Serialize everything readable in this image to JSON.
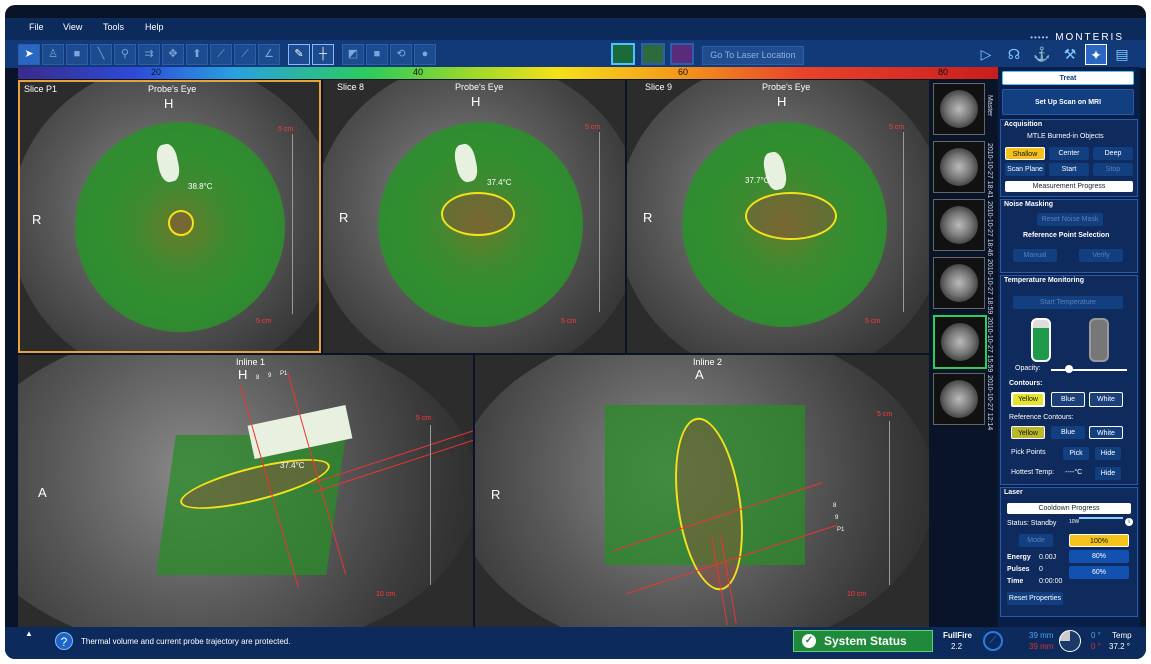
{
  "menu": {
    "file": "File",
    "view": "View",
    "tools": "Tools",
    "help": "Help"
  },
  "brand": {
    "name": "MONTERIS",
    "dots": "•••••"
  },
  "toolbar": {
    "goto": "Go To Laser Location"
  },
  "colorbar": {
    "t20": "20",
    "t40": "40",
    "t60": "60",
    "t80": "80"
  },
  "views": {
    "v1": {
      "slice": "Slice P1",
      "title": "Probe's Eye",
      "top": "H",
      "left": "R",
      "scale_top": "5 cm",
      "scale_bot": "5 cm",
      "temp": "38.8°C"
    },
    "v2": {
      "slice": "Slice 8",
      "title": "Probe's Eye",
      "top": "H",
      "left": "R",
      "scale_top": "5 cm",
      "scale_bot": "5 cm",
      "temp": "37.4°C"
    },
    "v3": {
      "slice": "Slice 9",
      "title": "Probe's Eye",
      "top": "H",
      "left": "R",
      "scale_top": "5 cm",
      "scale_bot": "5 cm",
      "temp": "37.7°C"
    },
    "v4": {
      "title": "Inline 1",
      "top": "H",
      "left": "A",
      "scale_top": "5 cm",
      "scale_bot": "10 cm",
      "temp": "37.4°C",
      "s8": "8",
      "s9": "9",
      "sp": "P1"
    },
    "v5": {
      "title": "Inline 2",
      "top": "A",
      "left": "R",
      "scale_top": "5 cm",
      "scale_bot": "10 cm",
      "s8": "8",
      "s9": "9",
      "sp": "P1"
    }
  },
  "thumbs": {
    "master": "Master",
    "t1": "2010-10-27 18:41",
    "t2": "2010-10-27 18:46",
    "t3": "2010-10-27 18:59",
    "t4": "2010-10-27 15:59",
    "t5": "2010-10-27 12:14"
  },
  "panel": {
    "treat": "Treat",
    "setup": "Set Up Scan on MRI",
    "acq": {
      "head": "Acquisition",
      "sub": "MTLE Burned-in Objects",
      "shallow": "Shallow",
      "center": "Center",
      "deep": "Deep",
      "scanplane": "Scan Plane",
      "start": "Start",
      "stop": "Stop",
      "progress": "Measurement Progress"
    },
    "noise": {
      "head": "Noise Masking",
      "reset": "Reset Noise Mask",
      "ref": "Reference Point Selection",
      "manual": "Manual",
      "verify": "Verify"
    },
    "temp": {
      "head": "Temperature Monitoring",
      "start": "Start Temperature",
      "opacity": "Opacity:",
      "contours": "Contours:",
      "yellow": "Yellow",
      "blue": "Blue",
      "white": "White",
      "refc": "Reference Contours:",
      "ryellow": "Yellow",
      "rblue": "Blue",
      "rwhite": "White",
      "pick_label": "Pick Points",
      "pick": "Pick",
      "hide": "Hide",
      "hottest": "Hottest Temp:",
      "hottest_val": "----°C",
      "hide2": "Hide"
    },
    "laser": {
      "head": "Laser",
      "cooldown": "Cooldown Progress",
      "status": "Status: Standby",
      "mode": "Mode",
      "tenw": "10W",
      "p100": "100%",
      "p80": "80%",
      "p60": "60%",
      "energy_l": "Energy",
      "energy_v": "0.00J",
      "pulses_l": "Pulses",
      "pulses_v": "0",
      "time_l": "Time",
      "time_v": "0:00:00",
      "reset": "Reset Properties"
    }
  },
  "status": {
    "msg": "Thermal volume and current probe trajectory are protected.",
    "system": "System Status",
    "fullfire_l": "FullFire",
    "fullfire_v": "2.2",
    "mm1": "39 mm",
    "mm2": "39 mm",
    "deg1": "0 °",
    "deg2": "0 °",
    "temp_l": "Temp",
    "temp_v": "37.2 °"
  }
}
